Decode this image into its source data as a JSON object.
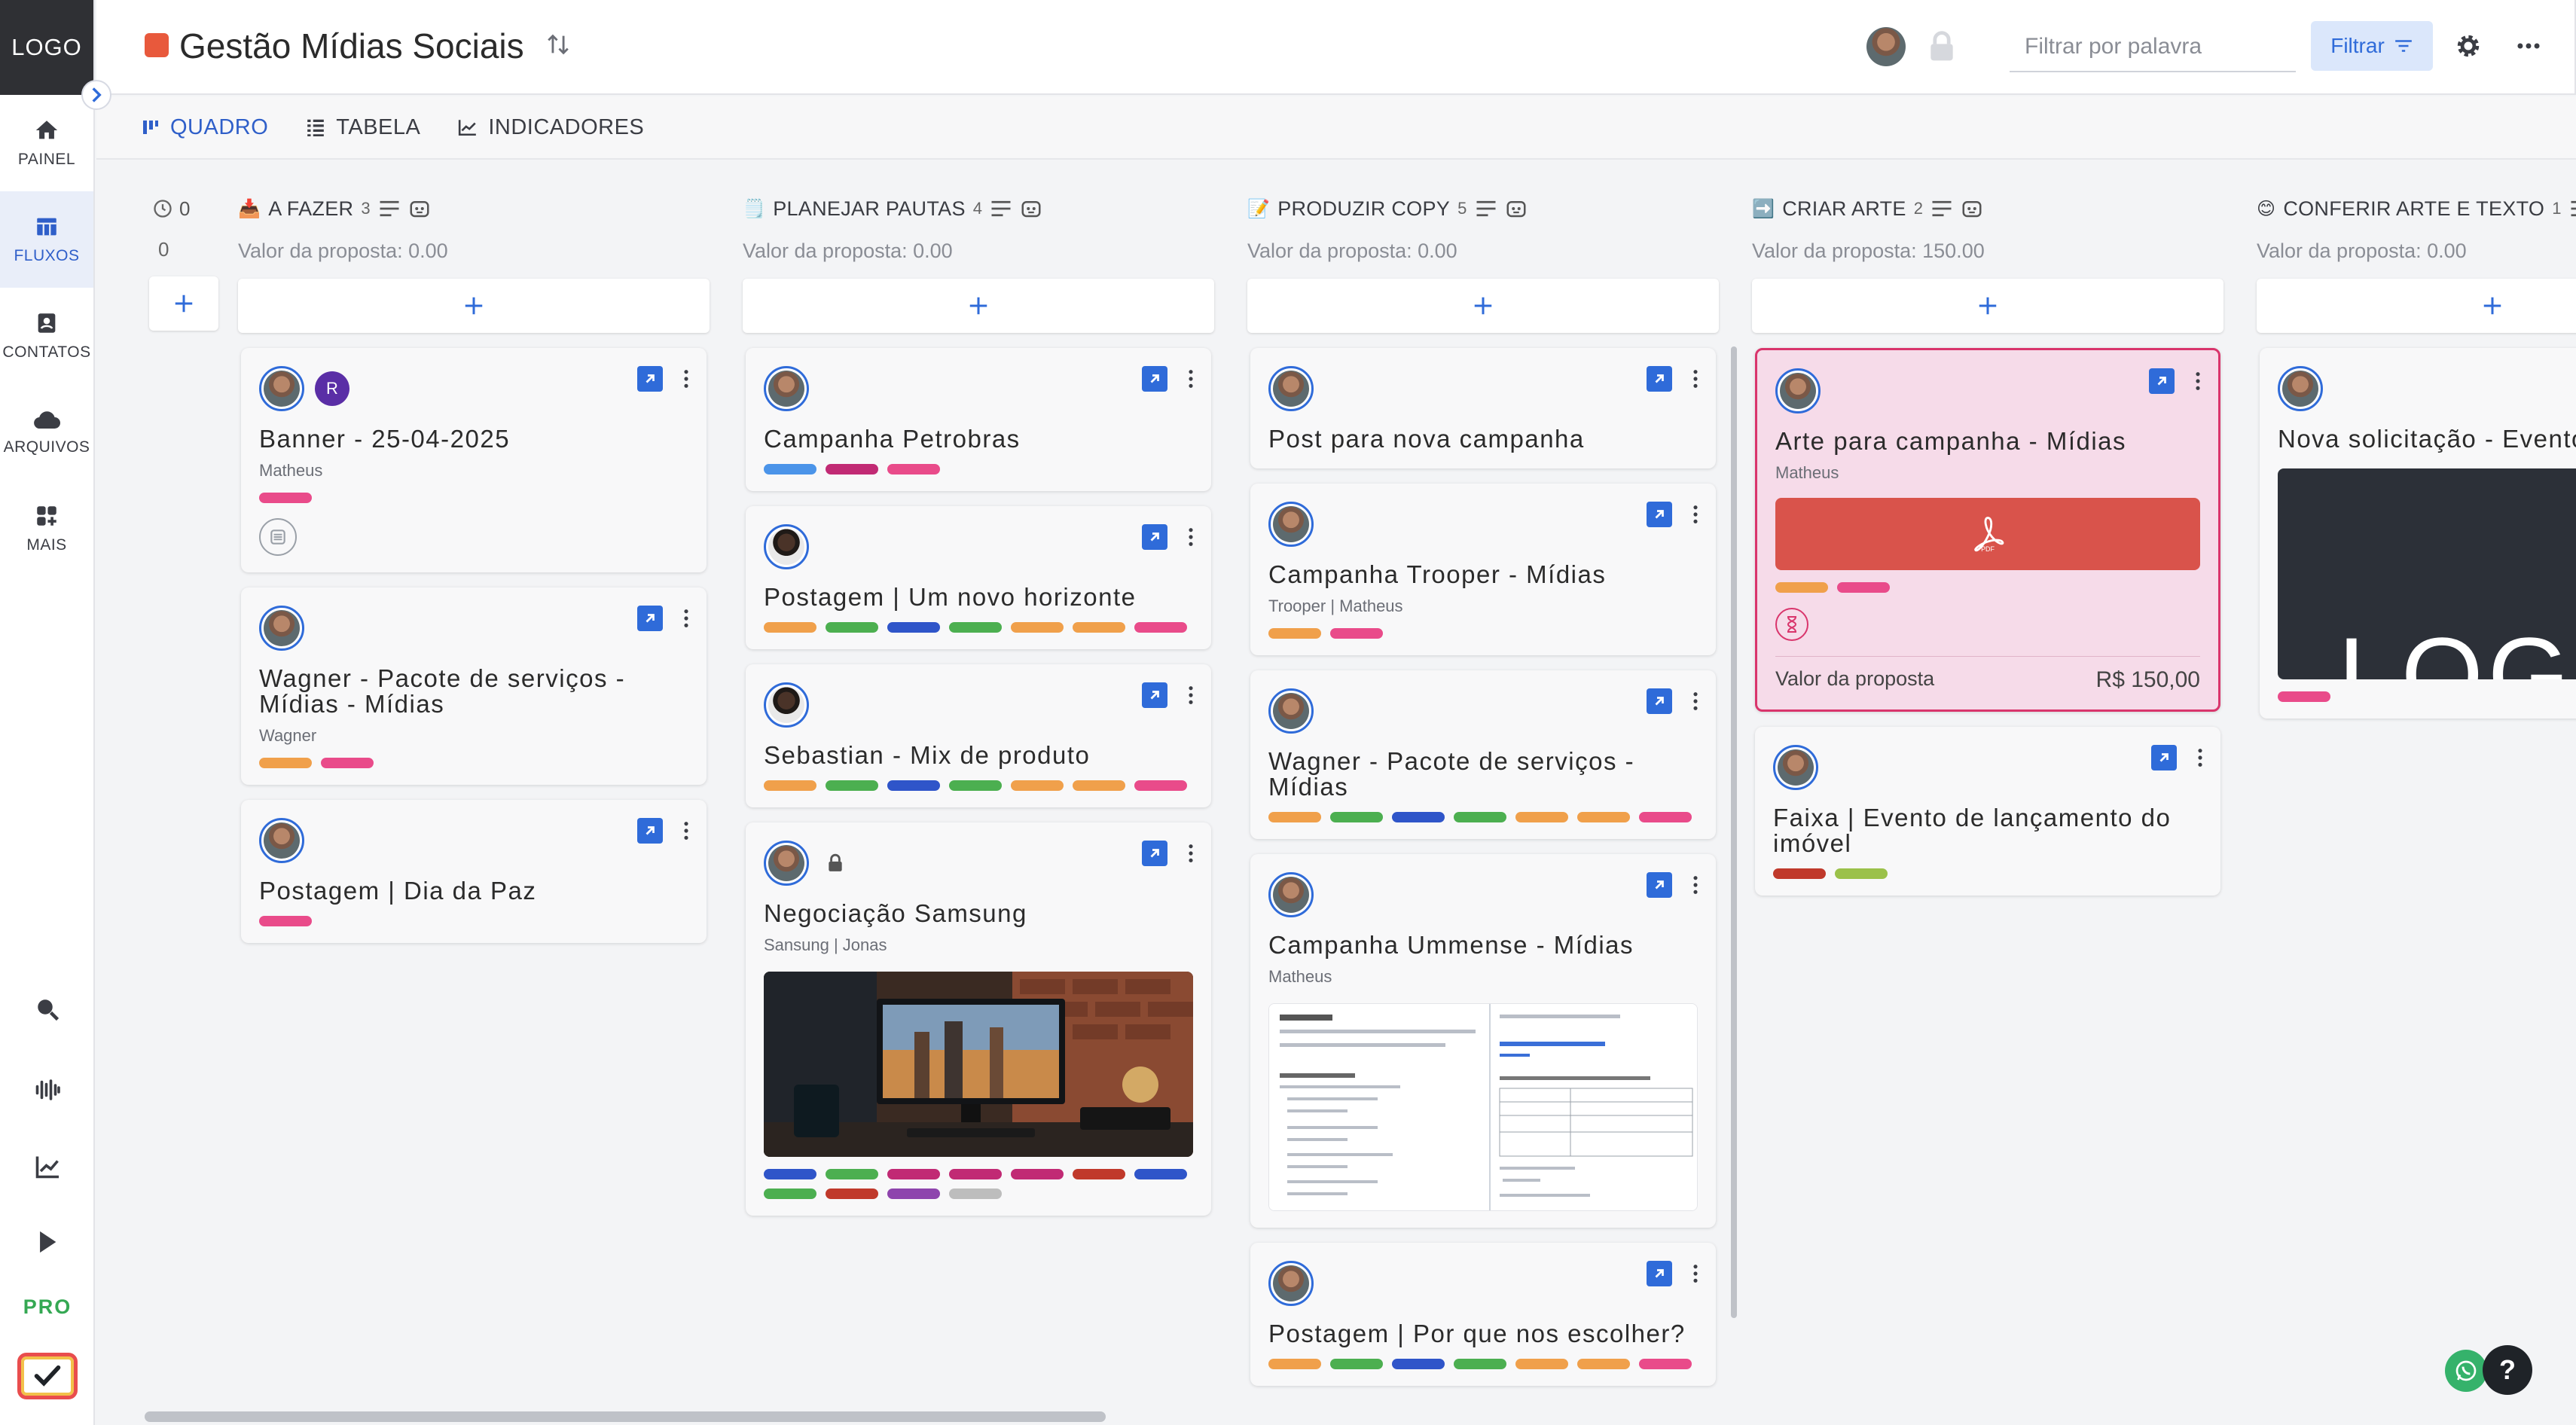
{
  "app": {
    "logo": "LOGO",
    "title": "Gestão Mídias Sociais"
  },
  "sidebar": {
    "items": [
      {
        "label": "PAINEL",
        "icon": "home-icon"
      },
      {
        "label": "FLUXOS",
        "icon": "table-icon"
      },
      {
        "label": "CONTATOS",
        "icon": "contacts-icon"
      },
      {
        "label": "ARQUIVOS",
        "icon": "cloud-icon"
      },
      {
        "label": "MAIS",
        "icon": "grid-plus-icon"
      }
    ],
    "pro_label": "PRO"
  },
  "header": {
    "search_placeholder": "Filtrar por palavra",
    "filter_label": "Filtrar"
  },
  "tabs": [
    {
      "label": "QUADRO",
      "active": true
    },
    {
      "label": "TABELA",
      "active": false
    },
    {
      "label": "INDICADORES",
      "active": false
    }
  ],
  "counter": {
    "head": "0",
    "value": "0"
  },
  "columns": [
    {
      "emoji": "📥",
      "title": "A FAZER",
      "count": "3",
      "subtitle": "Valor da proposta: 0.00",
      "cards": [
        {
          "title": "Banner - 25-04-2025",
          "sub": "Matheus",
          "extra_avatar": "R",
          "tags": [
            "#e94b8a"
          ],
          "icon": "list-icon"
        },
        {
          "title": "Wagner - Pacote de serviços - Mídias - Mídias",
          "sub": "Wagner",
          "tags": [
            "#f0a04b",
            "#e94b8a"
          ]
        },
        {
          "title": "Postagem | Dia da Paz",
          "sub": "",
          "tags": [
            "#e94b8a"
          ]
        }
      ]
    },
    {
      "emoji": "🗒️",
      "title": "PLANEJAR PAUTAS",
      "count": "4",
      "subtitle": "Valor da proposta: 0.00",
      "cards": [
        {
          "title": "Campanha Petrobras",
          "sub": "",
          "tags": [
            "#4b94e9",
            "#c12a74",
            "#e94b8a"
          ]
        },
        {
          "title": "Postagem | Um novo horizonte",
          "sub": "",
          "tags": [
            "#f0a04b",
            "#4caf50",
            "#2f55c9",
            "#4caf50",
            "#f0a04b",
            "#f0a04b",
            "#e94b8a"
          ],
          "dark_avatar": true
        },
        {
          "title": "Sebastian - Mix de produto",
          "sub": "",
          "tags": [
            "#f0a04b",
            "#4caf50",
            "#2f55c9",
            "#4caf50",
            "#f0a04b",
            "#f0a04b",
            "#e94b8a"
          ],
          "dark_avatar": true
        },
        {
          "title": "Negociação Samsung",
          "sub": "Sansung | Jonas",
          "tags": [
            "#2f55c9",
            "#4caf50",
            "#c12a74",
            "#c12a74",
            "#c12a74",
            "#c0392b",
            "#2f55c9",
            "#4caf50",
            "#c0392b",
            "#8e44ad",
            "#bdbdbd"
          ],
          "locked": true,
          "image": "workspace"
        }
      ]
    },
    {
      "emoji": "📝",
      "title": "PRODUZIR COPY",
      "count": "5",
      "subtitle": "Valor da proposta: 0.00",
      "cards": [
        {
          "title": "Post para nova campanha",
          "sub": "",
          "tags": []
        },
        {
          "title": "Campanha Trooper - Mídias",
          "sub": "Trooper | Matheus",
          "tags": [
            "#f0a04b",
            "#e94b8a"
          ]
        },
        {
          "title": "Wagner - Pacote de serviços - Mídias",
          "sub": "",
          "tags": [
            "#f0a04b",
            "#4caf50",
            "#2f55c9",
            "#4caf50",
            "#f0a04b",
            "#f0a04b",
            "#e94b8a"
          ]
        },
        {
          "title": "Campanha Ummense - Mídias",
          "sub": "Matheus",
          "tags": [],
          "image": "doc"
        },
        {
          "title": "Postagem | Por que nos escolher?",
          "sub": "",
          "tags": [
            "#f0a04b",
            "#4caf50",
            "#2f55c9",
            "#4caf50",
            "#f0a04b",
            "#f0a04b",
            "#e94b8a"
          ]
        }
      ]
    },
    {
      "emoji": "➡️",
      "title": "CRIAR ARTE",
      "count": "2",
      "subtitle": "Valor da proposta: 150.00",
      "cards": [
        {
          "title": "Arte para campanha - Mídias",
          "sub": "Matheus",
          "tags": [
            "#f0a04b",
            "#e94b8a"
          ],
          "pdf": true,
          "pdf_label": "PDF",
          "hourglass": true,
          "value_label": "Valor da proposta",
          "value": "R$ 150,00",
          "pink": true
        },
        {
          "title": "Faixa | Evento de lançamento do imóvel",
          "sub": "",
          "tags": [
            "#c0392b",
            "#9bc14a"
          ]
        }
      ]
    },
    {
      "emoji": "😊",
      "title": "CONFERIR ARTE E TEXTO",
      "count": "1",
      "subtitle": "Valor da proposta: 0.00",
      "cards": [
        {
          "title": "Nova solicitação - Evento",
          "sub": "",
          "tags": [
            "#e94b8a"
          ],
          "image": "logo-dark",
          "image_text": "LOG"
        }
      ]
    }
  ],
  "colors": {
    "accent": "#2f6bd9",
    "pink_card_border": "#d9356c"
  }
}
